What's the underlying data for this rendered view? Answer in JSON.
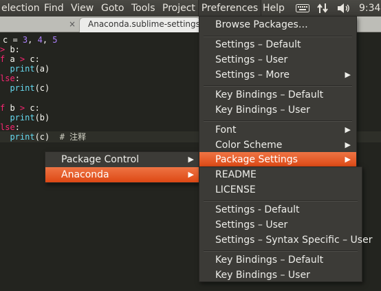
{
  "menubar": {
    "items": [
      "election",
      "Find",
      "View",
      "Goto",
      "Tools",
      "Project",
      "Preferences",
      "Help"
    ],
    "active": "Preferences",
    "clock": "9:34"
  },
  "tabs": {
    "close_glyph": "×",
    "active_label": "Anaconda.sublime-settings",
    "active_close_glyph": "×"
  },
  "editor": {
    "lines": [
      "c = 3, 4, 5",
      "> b:",
      "f a > c:",
      "  print(a)",
      "lse:",
      "  print(c)",
      "",
      "f b > c:",
      "  print(b)",
      "lse:",
      "  print(c)  # 注释"
    ]
  },
  "preferences_menu": {
    "items": [
      {
        "label": "Browse Packages…"
      },
      {
        "label": "Settings – Default"
      },
      {
        "label": "Settings – User"
      },
      {
        "label": "Settings – More",
        "submenu": true
      },
      {
        "label": "Key Bindings – Default"
      },
      {
        "label": "Key Bindings – User"
      },
      {
        "label": "Font",
        "submenu": true
      },
      {
        "label": "Color Scheme",
        "submenu": true
      },
      {
        "label": "Package Settings",
        "submenu": true,
        "highlighted": true
      }
    ]
  },
  "package_settings_menu": {
    "items": [
      {
        "label": "Package Control",
        "submenu": true
      },
      {
        "label": "Anaconda",
        "submenu": true,
        "highlighted": true
      }
    ]
  },
  "anaconda_menu": {
    "items": [
      {
        "label": "README"
      },
      {
        "label": "LICENSE"
      },
      {
        "label": "Settings - Default"
      },
      {
        "label": "Settings – User"
      },
      {
        "label": "Settings – Syntax Specific – User"
      },
      {
        "label": "Key Bindings – Default"
      },
      {
        "label": "Key Bindings – User"
      }
    ]
  },
  "icons": {
    "submenu_arrow": "▶",
    "tray": [
      "keyboard-icon",
      "network-arrows-icon",
      "volume-icon"
    ]
  },
  "colors": {
    "highlight": "#e95420",
    "menu_bg": "#3c3b37",
    "editor_bg": "#23241f"
  }
}
